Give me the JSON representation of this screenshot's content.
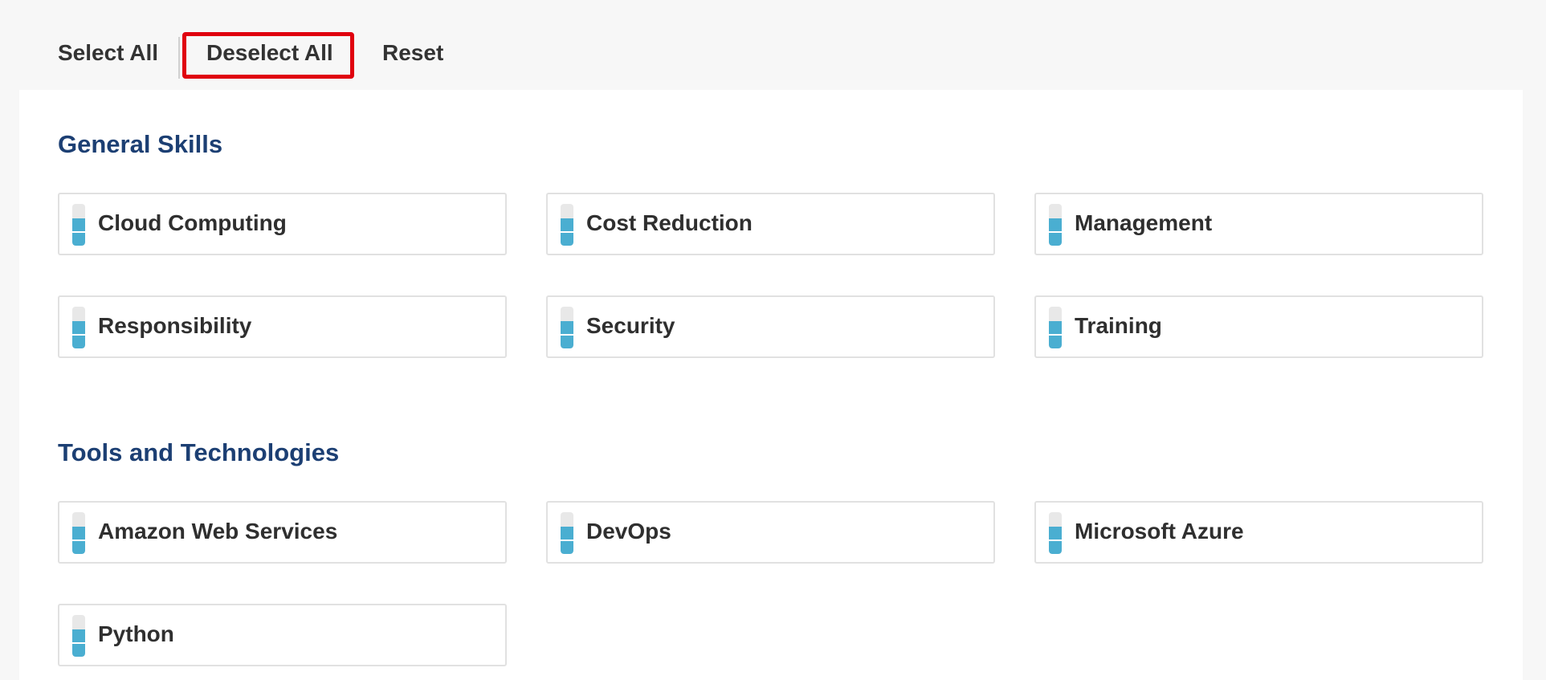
{
  "toolbar": {
    "select_all": "Select All",
    "deselect_all": "Deselect All",
    "reset": "Reset"
  },
  "sections": [
    {
      "title": "General Skills",
      "skills": [
        "Cloud Computing",
        "Cost Reduction",
        "Management",
        "Responsibility",
        "Security",
        "Training"
      ]
    },
    {
      "title": "Tools and Technologies",
      "skills": [
        "Amazon Web Services",
        "DevOps",
        "Microsoft Azure",
        "Python"
      ]
    }
  ],
  "colors": {
    "section_title": "#1c3f73",
    "meter_fill": "#4aaed1",
    "highlight": "#e0000f"
  }
}
